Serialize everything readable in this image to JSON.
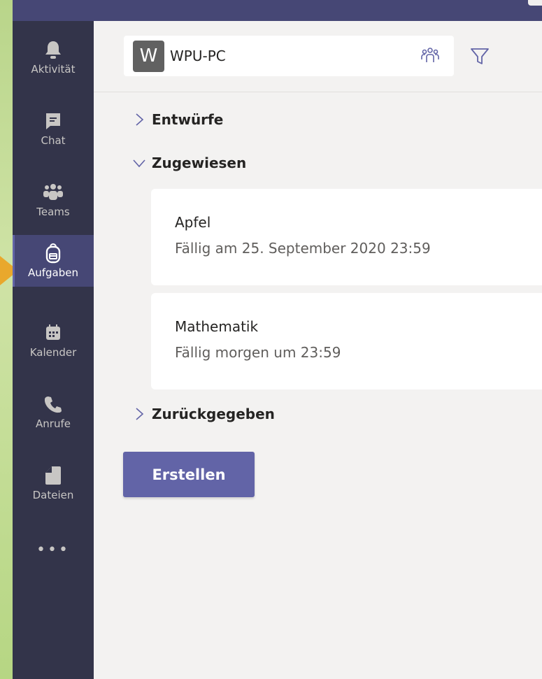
{
  "rail": {
    "items": [
      {
        "label": "Aktivität",
        "icon": "bell-icon"
      },
      {
        "label": "Chat",
        "icon": "chat-icon"
      },
      {
        "label": "Teams",
        "icon": "teams-icon"
      },
      {
        "label": "Aufgaben",
        "icon": "backpack-icon",
        "active": true
      },
      {
        "label": "Kalender",
        "icon": "calendar-icon"
      },
      {
        "label": "Anrufe",
        "icon": "phone-icon"
      },
      {
        "label": "Dateien",
        "icon": "file-icon"
      }
    ],
    "more": "•••"
  },
  "header": {
    "avatar_letter": "W",
    "team_name": "WPU-PC"
  },
  "sections": {
    "drafts": "Entwürfe",
    "assigned": "Zugewiesen",
    "returned": "Zurückgegeben"
  },
  "assignments": [
    {
      "title": "Apfel",
      "due": "Fällig am 25. September 2020 23:59"
    },
    {
      "title": "Mathematik",
      "due": "Fällig morgen um 23:59"
    }
  ],
  "create_button": "Erstellen",
  "colors": {
    "accent": "#6264a7",
    "rail": "#33344a",
    "rail_active": "#464775",
    "pointer": "#e9a82c"
  }
}
